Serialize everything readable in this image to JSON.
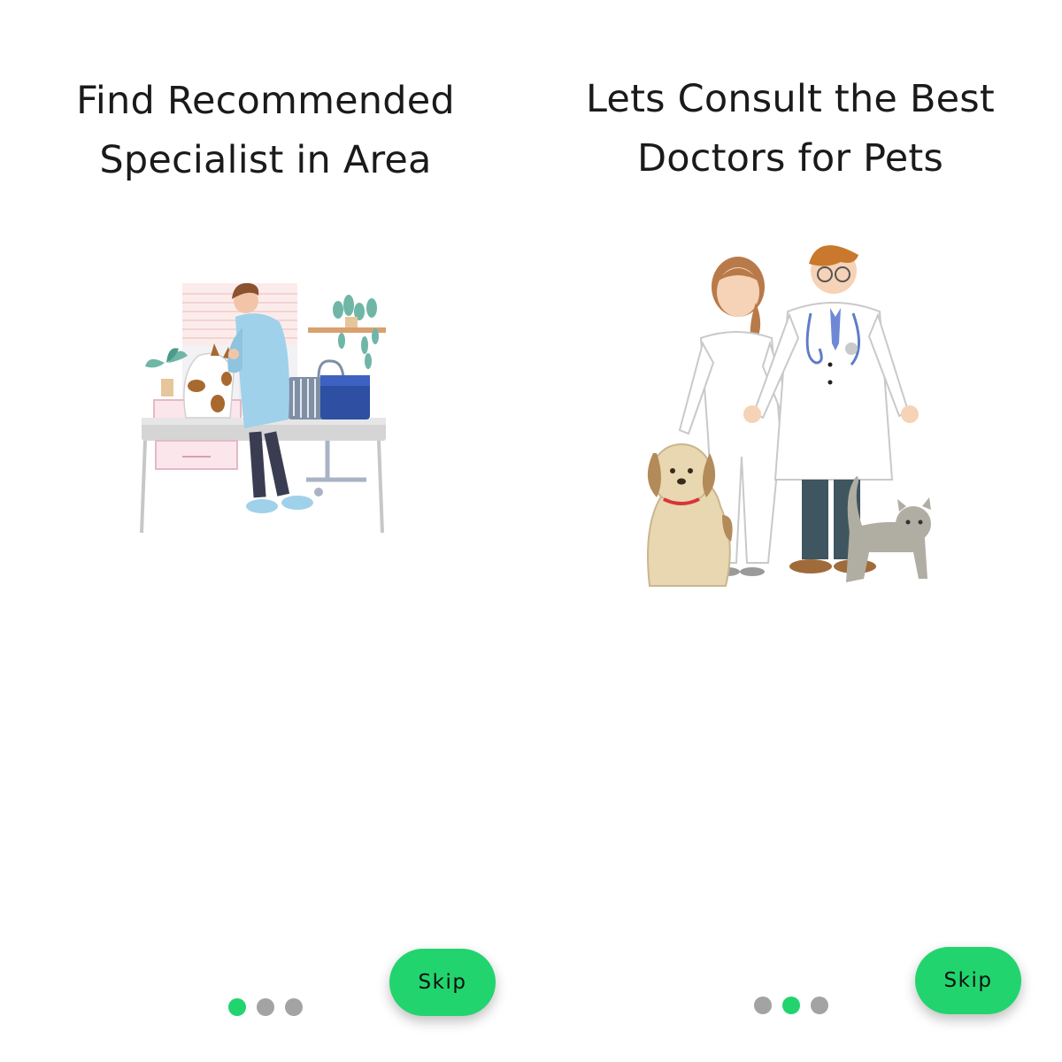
{
  "screens": [
    {
      "title_line1": "Find Recommended",
      "title_line2": "Specialist in Area",
      "illustration": "vet-examining-dog-illustration",
      "pager": {
        "total": 3,
        "active": 1
      },
      "skip_label": "Skip"
    },
    {
      "title_line1": "Lets Consult the Best",
      "title_line2": "Doctors for Pets",
      "illustration": "doctors-with-dog-and-cat-illustration",
      "pager": {
        "total": 3,
        "active": 2
      },
      "skip_label": "Skip"
    }
  ],
  "colors": {
    "accent": "#22d46e",
    "dot_inactive": "#a3a3a3",
    "title_text": "#1a1a1a"
  }
}
